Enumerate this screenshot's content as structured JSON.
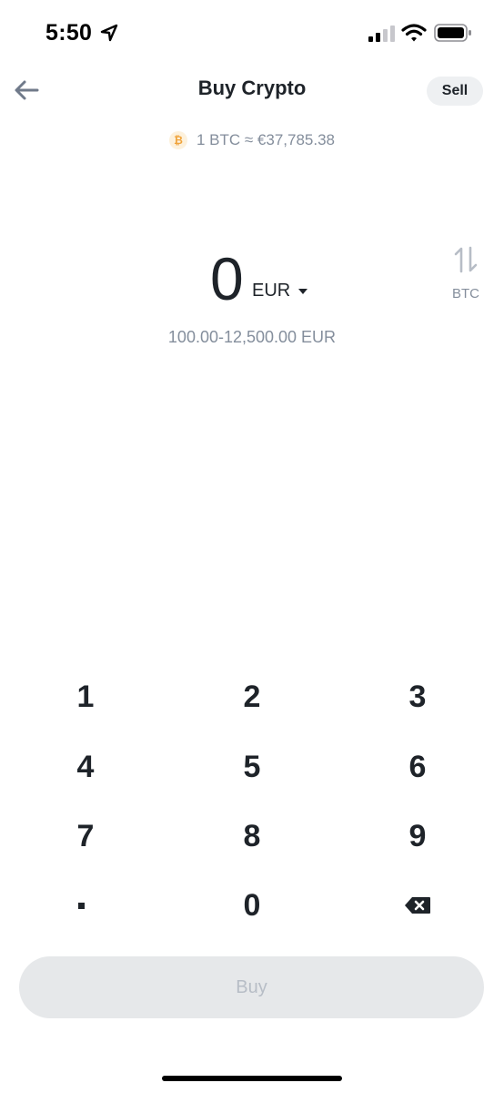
{
  "status_bar": {
    "time": "5:50"
  },
  "header": {
    "title": "Buy Crypto",
    "sell_label": "Sell"
  },
  "rate": {
    "coin_symbol": "₿",
    "text": "1 BTC ≈ €37,785.38"
  },
  "amount": {
    "value": "0",
    "fiat_code": "EUR",
    "swap_label": "BTC",
    "limits": "100.00-12,500.00 EUR"
  },
  "keypad": {
    "keys": [
      "1",
      "2",
      "3",
      "4",
      "5",
      "6",
      "7",
      "8",
      "9",
      ".",
      "0",
      "⌫"
    ]
  },
  "buy_label": "Buy",
  "colors": {
    "text_primary": "#1e2329",
    "text_secondary": "#848e9c",
    "btc_orange": "#f0a33a",
    "disabled_button_bg": "#e6e8ea",
    "disabled_button_text": "#b7bdc6"
  },
  "icons": {
    "back": "arrow-left-icon",
    "swap": "swap-arrows-icon",
    "backspace": "backspace-icon",
    "location": "location-arrow-icon",
    "signal": "cellular-signal-icon",
    "wifi": "wifi-icon",
    "battery": "battery-icon"
  }
}
